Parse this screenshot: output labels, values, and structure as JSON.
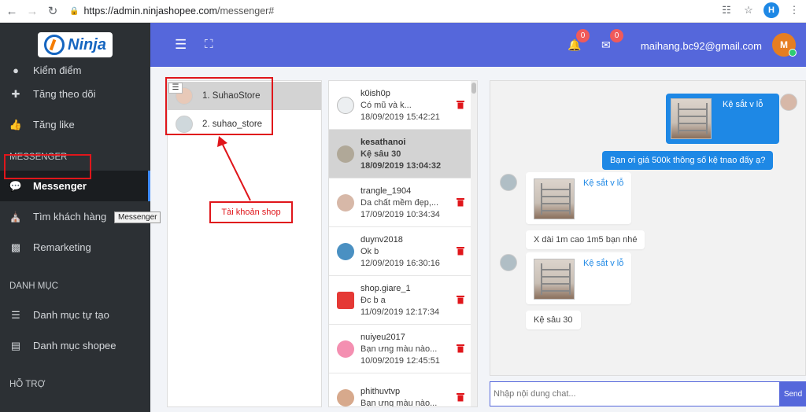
{
  "browser": {
    "url_host": "https://admin.ninjashopee.com",
    "url_path": "/messenger#",
    "profile_initial": "H"
  },
  "brand": {
    "logo_text": "Ninja"
  },
  "sidebar": {
    "partial_item": "Kiểm điểm",
    "items_top": [
      {
        "label": "Tăng theo dõi",
        "icon": "user-plus-icon"
      },
      {
        "label": "Tăng like",
        "icon": "thumbs-up-icon"
      }
    ],
    "section_messenger": "MESSENGER",
    "messenger_items": [
      {
        "label": "Messenger",
        "icon": "chat-icon",
        "active": true
      },
      {
        "label": "Tìm khách hàng",
        "icon": "bank-icon"
      },
      {
        "label": "Remarketing",
        "icon": "money-icon"
      }
    ],
    "section_danhmuc": "DANH MỤC",
    "danhmuc_items": [
      {
        "label": "Danh mục tự tạo",
        "icon": "list-icon"
      },
      {
        "label": "Danh mục shopee",
        "icon": "list-alt-icon"
      }
    ],
    "section_hotro": "HỖ TRỢ",
    "tooltip": "Messenger"
  },
  "header": {
    "bell_count": "0",
    "mail_count": "0",
    "email": "maihang.bc92@gmail.com",
    "avatar_initial": "M"
  },
  "shops": [
    {
      "label": "1. SuhaoStore",
      "selected": true
    },
    {
      "label": "2. suhao_store",
      "selected": false
    }
  ],
  "annotation": "Tài khoản shop",
  "conversations": [
    {
      "name": "k0ish0p",
      "preview": "Có mũ và k...",
      "time": "18/09/2019 15:42:21",
      "selected": false
    },
    {
      "name": "kesathanoi",
      "preview": "Kệ sâu 30",
      "time": "18/09/2019 13:04:32",
      "selected": true
    },
    {
      "name": "trangle_1904",
      "preview": "Da chất mềm đẹp,...",
      "time": "17/09/2019 10:34:34",
      "selected": false
    },
    {
      "name": "duynv2018",
      "preview": "Ok b",
      "time": "12/09/2019 16:30:16",
      "selected": false
    },
    {
      "name": "shop.giare_1",
      "preview": "Đc b a",
      "time": "11/09/2019 12:17:34",
      "selected": false
    },
    {
      "name": "nuiyeu2017",
      "preview": "Bạn ưng màu nào...",
      "time": "10/09/2019 12:45:51",
      "selected": false
    },
    {
      "name": "phithuvtvp",
      "preview": "Bạn ưng màu nào...",
      "time": "",
      "selected": false
    }
  ],
  "chat": {
    "msg1_link": "Kệ sắt v lỗ",
    "msg2": "Bạn ơi giá 500k thông số kệ tnao đấy ạ?",
    "msg3_link": "Kệ sắt v lỗ",
    "msg4": "X dài 1m cao 1m5 bạn nhé",
    "msg5_link": "Kệ sắt v lỗ",
    "msg6": "Kệ sâu 30",
    "input_placeholder": "Nhập nội dung chat...",
    "send_label": "Send"
  },
  "colors": {
    "header_bg": "#5567db",
    "sidebar_bg": "#2c3034",
    "bubble_blue": "#1e88e5",
    "annotation_red": "#e0161b"
  }
}
